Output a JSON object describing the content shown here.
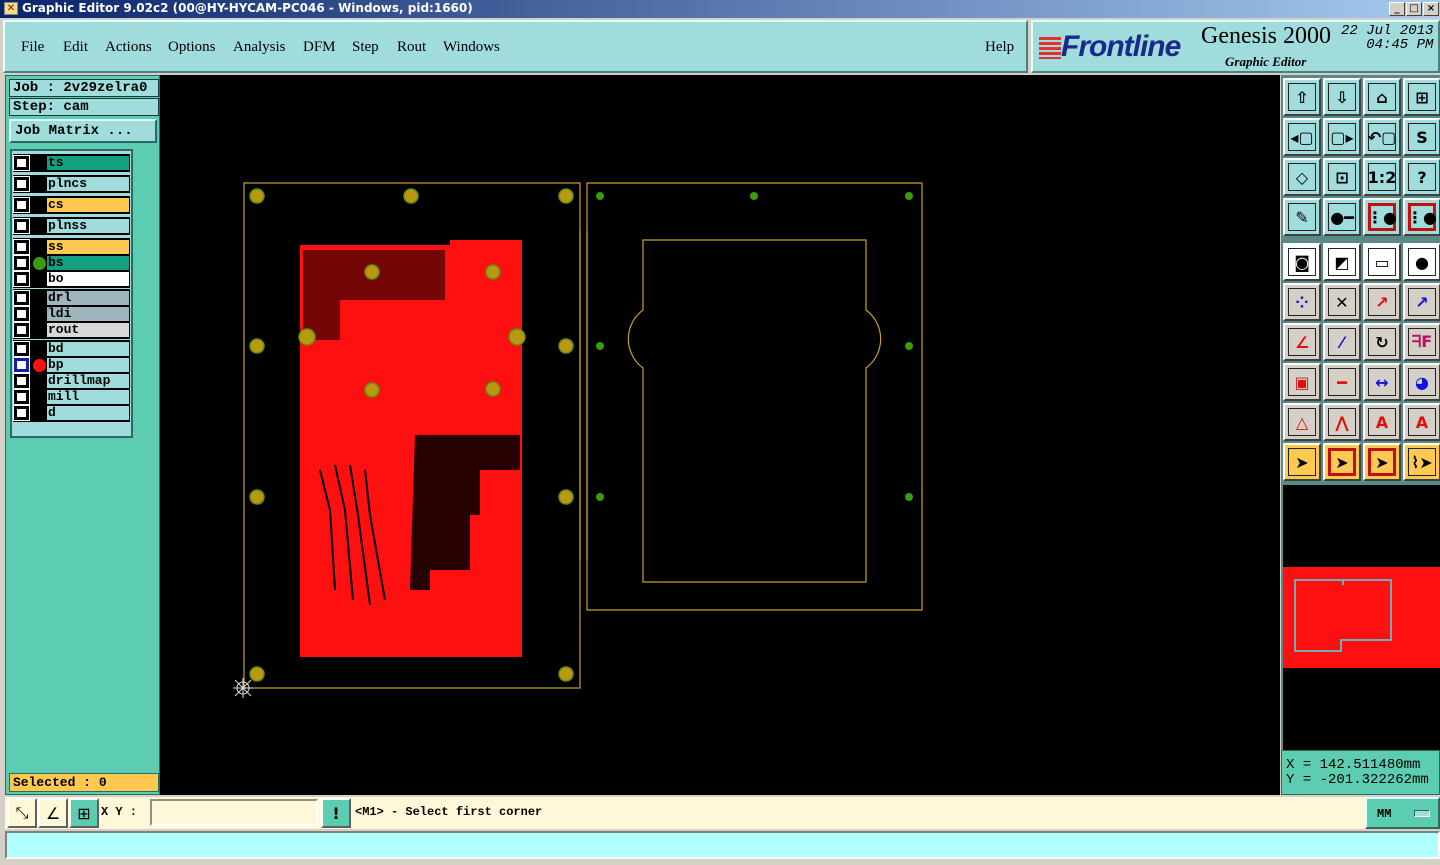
{
  "window": {
    "title": "Graphic Editor 9.02c2 (00@HY-HYCAM-PC046 - Windows, pid:1660)",
    "controls": [
      "_",
      "□",
      "×"
    ]
  },
  "menu": {
    "items": [
      "File",
      "Edit",
      "Actions",
      "Options",
      "Analysis",
      "DFM",
      "Step",
      "Rout",
      "Windows"
    ],
    "help": "Help"
  },
  "brand": {
    "logo": "Frontline",
    "product": "Genesis 2000",
    "subtitle": "Graphic Editor",
    "date": "22 Jul 2013",
    "time": "04:45 PM"
  },
  "job": {
    "job_label": "Job : 2v29zelra0",
    "step_label": "Step: cam",
    "matrix_button": "Job Matrix ..."
  },
  "layers": [
    {
      "name": "ts",
      "color": "#12a080",
      "group": 0
    },
    {
      "name": "plncs",
      "color": "#a0dcdc",
      "group": 1
    },
    {
      "name": "cs",
      "color": "#ffc850",
      "group": 2
    },
    {
      "name": "plnss",
      "color": "#a0dcdc",
      "group": 3
    },
    {
      "name": "ss",
      "color": "#ffc850",
      "group": 4
    },
    {
      "name": "bs",
      "color": "#12a080",
      "group": 4,
      "display": "#3a9a10"
    },
    {
      "name": "bo",
      "color": "#ffffff",
      "group": 4
    },
    {
      "name": "drl",
      "color": "#a0b4bc",
      "group": 5
    },
    {
      "name": "ldi",
      "color": "#a0b4bc",
      "group": 5
    },
    {
      "name": "rout",
      "color": "#d8d8d8",
      "group": 5
    },
    {
      "name": "bd",
      "color": "#a0dcdc",
      "group": 6
    },
    {
      "name": "bp",
      "color": "#a0dcdc",
      "group": 6,
      "display": "#ff1010",
      "work": true
    },
    {
      "name": "drillmap",
      "color": "#a0dcdc",
      "group": 6
    },
    {
      "name": "mill",
      "color": "#a0dcdc",
      "group": 6
    },
    {
      "name": "d",
      "color": "#a0dcdc",
      "group": 6
    }
  ],
  "selected": "Selected : 0",
  "coords": {
    "x": "X = 142.511480mm",
    "y": "Y = -201.322262mm"
  },
  "bottom": {
    "xy_label": "X Y :",
    "xy_value": "",
    "prompt": "<M1> - Select first corner",
    "units": "MM"
  },
  "colors": {
    "panel": "#a0dcdc",
    "accent": "#5ccdb0",
    "copper": "#ff1010",
    "pad": "#b89a10",
    "outline": "#c8a030"
  },
  "tools": [
    {
      "icon": "window-up-icon",
      "g": "⇧",
      "bg": "#a0dcdc"
    },
    {
      "icon": "window-down-icon",
      "g": "⇩",
      "bg": "#a0dcdc"
    },
    {
      "icon": "home-icon",
      "g": "⌂",
      "bg": "#a0dcdc"
    },
    {
      "icon": "grid-xy-icon",
      "g": "⊞",
      "bg": "#a0dcdc"
    },
    {
      "icon": "pan-left-icon",
      "g": "◂▢",
      "bg": "#a0dcdc"
    },
    {
      "icon": "pan-right-icon",
      "g": "▢▸",
      "bg": "#a0dcdc"
    },
    {
      "icon": "undo-view-icon",
      "g": "↶▢",
      "bg": "#a0dcdc"
    },
    {
      "icon": "snap-icon",
      "g": "S",
      "bg": "#a0dcdc"
    },
    {
      "icon": "zoom-fit-icon",
      "g": "◇",
      "bg": "#a0dcdc"
    },
    {
      "icon": "zoom-in-icon",
      "g": "⊡",
      "bg": "#a0dcdc"
    },
    {
      "icon": "scale-1-2-icon",
      "g": "1:2",
      "bg": "#a0dcdc"
    },
    {
      "icon": "help-icon",
      "g": "?",
      "bg": "#a0dcdc"
    },
    {
      "icon": "tools-palette-icon",
      "g": "✎",
      "bg": "#a0dcdc"
    },
    {
      "icon": "measure-pin-icon",
      "g": "●━",
      "bg": "#a0dcdc"
    },
    {
      "icon": "net-check-icon",
      "g": "⋮●",
      "bg": "#a0dcdc",
      "border": "#c01010"
    },
    {
      "icon": "net-check-2-icon",
      "g": "⋮●",
      "bg": "#a0dcdc",
      "border": "#c01010"
    },
    {
      "icon": "select-features-icon",
      "g": "◙",
      "bg": "#ffffff"
    },
    {
      "icon": "copy-features-icon",
      "g": "◩",
      "bg": "#ffffff"
    },
    {
      "icon": "ruler-icon",
      "g": "▭",
      "bg": "#ffffff"
    },
    {
      "icon": "pad-icon",
      "g": "●",
      "bg": "#ffffff"
    },
    {
      "icon": "connect-icon",
      "g": "⁘",
      "bg": "#d4d0c8",
      "c": "#1010e0"
    },
    {
      "icon": "delete-icon",
      "g": "✕",
      "bg": "#d4d0c8"
    },
    {
      "icon": "move-icon",
      "g": "↗",
      "bg": "#d4d0c8",
      "c": "#e01010"
    },
    {
      "icon": "move-pad-icon",
      "g": "↗",
      "bg": "#d4d0c8",
      "c": "#1010e0"
    },
    {
      "icon": "angle-icon",
      "g": "∠",
      "bg": "#d4d0c8",
      "c": "#e01010"
    },
    {
      "icon": "line-icon",
      "g": "⁄",
      "bg": "#d4d0c8",
      "c": "#1010e0"
    },
    {
      "icon": "rotate-icon",
      "g": "↻",
      "bg": "#d4d0c8"
    },
    {
      "icon": "mirror-icon",
      "g": "ᖷF",
      "bg": "#d4d0c8",
      "c": "#c01060"
    },
    {
      "icon": "resize-icon",
      "g": "▣",
      "bg": "#d4d0c8",
      "c": "#e01010"
    },
    {
      "icon": "split-line-icon",
      "g": "━",
      "bg": "#d4d0c8",
      "c": "#e01010"
    },
    {
      "icon": "dimension-icon",
      "g": "↔",
      "bg": "#d4d0c8",
      "c": "#1010e0"
    },
    {
      "icon": "contour-icon",
      "g": "◕",
      "bg": "#d4d0c8",
      "c": "#1010e0"
    },
    {
      "icon": "triangle-icon",
      "g": "△",
      "bg": "#d4d0c8",
      "c": "#e01010"
    },
    {
      "icon": "peak-icon",
      "g": "⋀",
      "bg": "#d4d0c8",
      "c": "#e01010"
    },
    {
      "icon": "arch-icon",
      "g": "A",
      "bg": "#d4d0c8",
      "c": "#e01010"
    },
    {
      "icon": "arch-line-icon",
      "g": "A",
      "bg": "#d4d0c8",
      "c": "#e01010"
    },
    {
      "icon": "pointer-icon",
      "g": "➤",
      "bg": "#ffc850"
    },
    {
      "icon": "pointer-box-icon",
      "g": "➤",
      "bg": "#ffc850",
      "border": "#c01010"
    },
    {
      "icon": "pointer-poly-icon",
      "g": "➤",
      "bg": "#ffc850",
      "border": "#c01010"
    },
    {
      "icon": "route-pointer-icon",
      "g": "⌇➤",
      "bg": "#ffc850"
    }
  ]
}
